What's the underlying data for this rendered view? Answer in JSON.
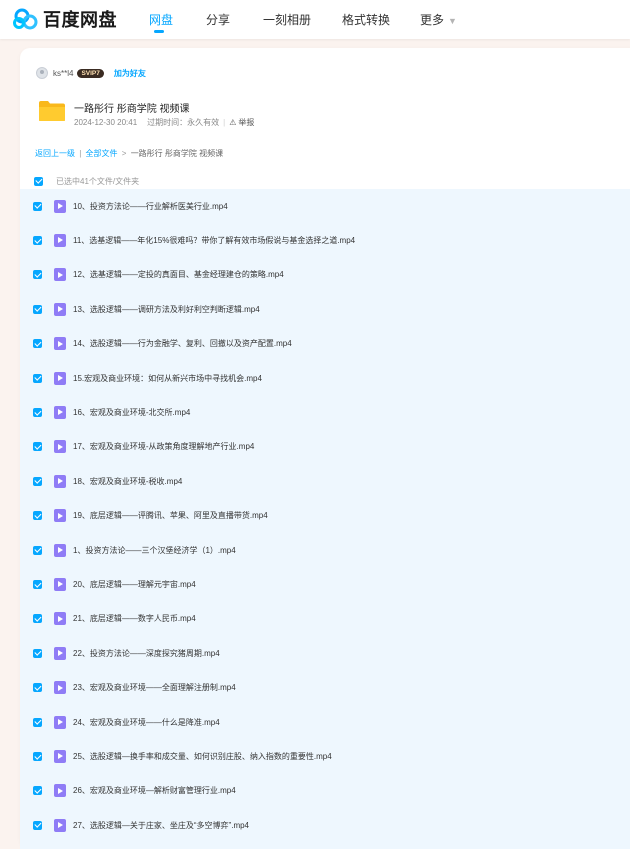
{
  "header": {
    "logo_text": "百度网盘",
    "nav": [
      {
        "label": "网盘",
        "active": true
      },
      {
        "label": "分享",
        "active": false
      },
      {
        "label": "一刻相册",
        "active": false
      },
      {
        "label": "格式转换",
        "active": false
      },
      {
        "label": "更多",
        "active": false
      }
    ]
  },
  "share": {
    "username": "ks**l4",
    "vip_badge": "SVIP7",
    "add_friend": "加为好友",
    "folder_title": "一路彤行 彤商学院 视频课",
    "date": "2024-12-30 20:41",
    "expire": "过期时间：永久有效",
    "report": "举报"
  },
  "breadcrumb": {
    "back": "返回上一级",
    "all_files": "全部文件",
    "current": "一路彤行 彤商学院 视频课"
  },
  "selection": {
    "summary": "已选中41个文件/文件夹"
  },
  "files": [
    "10、投资方法论——行业解析医美行业.mp4",
    "11、选基逻辑——年化15%很难吗？带你了解有效市场假说与基金选择之道.mp4",
    "12、选基逻辑——定投的真面目、基金经理建仓的策略.mp4",
    "13、选股逻辑——调研方法及利好利空判断逻辑.mp4",
    "14、选股逻辑——行为金融学、复利、回撤以及资产配置.mp4",
    "15.宏观及商业环境：如何从新兴市场中寻找机会.mp4",
    "16、宏观及商业环境-北交所.mp4",
    "17、宏观及商业环境-从政策角度理解地产行业.mp4",
    "18、宏观及商业环境-税收.mp4",
    "19、底层逻辑——评腾讯、苹果、阿里及直播带货.mp4",
    "1、投资方法论——三个汉堡经济学（1）.mp4",
    "20、底层逻辑——理解元宇宙.mp4",
    "21、底层逻辑——数字人民币.mp4",
    "22、投资方法论——深度探究猪周期.mp4",
    "23、宏观及商业环境——全面理解注册制.mp4",
    "24、宏观及商业环境——什么是降准.mp4",
    "25、选股逻辑—换手率和成交量、如何识别庄股、纳入指数的重要性.mp4",
    "26、宏观及商业环境—解析财富管理行业.mp4",
    "27、选股逻辑—关于庄家、坐庄及“多空博弈”.mp4"
  ],
  "colors": {
    "accent": "#06a7ff",
    "video_icon": "#8f7cf6",
    "list_bg": "#eef7fe",
    "page_bg": "#fbf3ef"
  }
}
